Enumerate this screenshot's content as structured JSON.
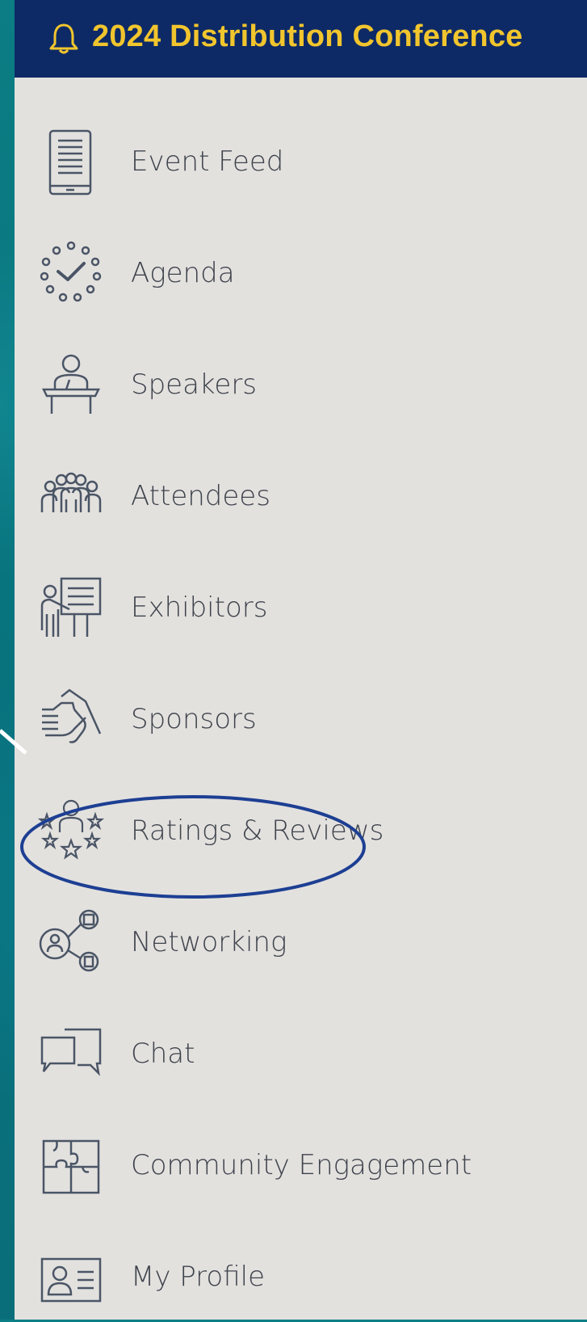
{
  "header": {
    "title": "2024 Distribution Conference",
    "icon": "bell-icon",
    "background": "#0d2a66",
    "title_color": "#f1c52d"
  },
  "menu": {
    "items": [
      {
        "label": "Event Feed",
        "icon": "tablet-icon"
      },
      {
        "label": "Agenda",
        "icon": "clock-check-icon"
      },
      {
        "label": "Speakers",
        "icon": "podium-speaker-icon"
      },
      {
        "label": "Attendees",
        "icon": "people-group-icon"
      },
      {
        "label": "Exhibitors",
        "icon": "presentation-board-icon"
      },
      {
        "label": "Sponsors",
        "icon": "handshake-icon"
      },
      {
        "label": "Ratings & Reviews",
        "icon": "person-stars-icon",
        "highlighted": true
      },
      {
        "label": "Networking",
        "icon": "network-people-icon"
      },
      {
        "label": "Chat",
        "icon": "chat-bubbles-icon"
      },
      {
        "label": "Community Engagement",
        "icon": "puzzle-icon"
      },
      {
        "label": "My Profile",
        "icon": "id-card-icon"
      }
    ],
    "label_color": "#3e434c",
    "highlight_color": "#1d3f93"
  }
}
